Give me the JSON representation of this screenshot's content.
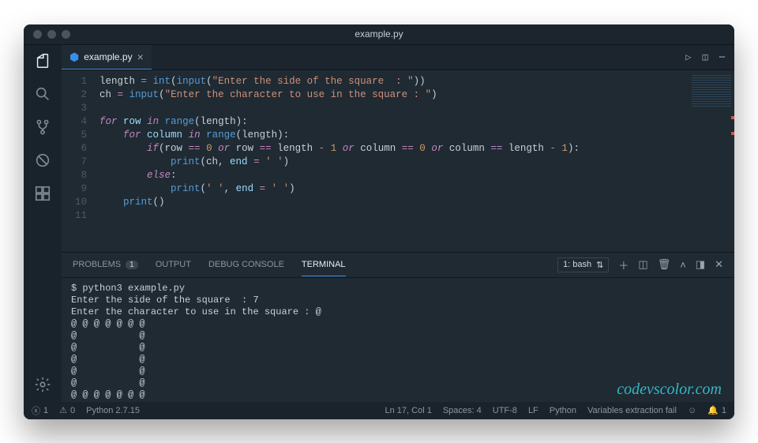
{
  "window": {
    "title": "example.py"
  },
  "tabs": {
    "file": "example.py"
  },
  "editor": {
    "lines": [
      "1",
      "2",
      "3",
      "4",
      "5",
      "6",
      "7",
      "8",
      "9",
      "10",
      "11"
    ],
    "code_html": "length <span class='tok-op'>=</span> <span class='tok-fn'>int</span>(<span class='tok-fn'>input</span>(<span class='tok-str'>\"Enter the side of the square  : \"</span>))\nch <span class='tok-op'>=</span> <span class='tok-fn'>input</span>(<span class='tok-str'>\"Enter the character to use in the square : \"</span>)\n\n<span class='tok-kw'>for</span> <span class='tok-id'>row</span> <span class='tok-kw'>in</span> <span class='tok-fn'>range</span>(length):\n    <span class='tok-kw'>for</span> <span class='tok-id'>column</span> <span class='tok-kw'>in</span> <span class='tok-fn'>range</span>(length):\n        <span class='tok-kw'>if</span>(row <span class='tok-op'>==</span> <span class='tok-num'>0</span> <span class='tok-kw'>or</span> row <span class='tok-op'>==</span> length <span class='tok-op'>-</span> <span class='tok-num'>1</span> <span class='tok-kw'>or</span> column <span class='tok-op'>==</span> <span class='tok-num'>0</span> <span class='tok-kw'>or</span> column <span class='tok-op'>==</span> length <span class='tok-op'>-</span> <span class='tok-num'>1</span>):\n            <span class='tok-fn'>print</span>(ch, <span class='tok-id'>end</span> <span class='tok-op'>=</span> <span class='tok-str'>' '</span>)\n        <span class='tok-kw'>else</span>:\n            <span class='tok-fn'>print</span>(<span class='tok-str'>' '</span>, <span class='tok-id'>end</span> <span class='tok-op'>=</span> <span class='tok-str'>' '</span>)\n    <span class='tok-fn'>print</span>()\n"
  },
  "panel": {
    "tabs": {
      "problems": "PROBLEMS",
      "problems_count": "1",
      "output": "OUTPUT",
      "debug": "DEBUG CONSOLE",
      "terminal": "TERMINAL"
    },
    "term_select": "1: bash",
    "terminal_text": "$ python3 example.py\nEnter the side of the square  : 7\nEnter the character to use in the square : @\n@ @ @ @ @ @ @ \n@           @ \n@           @ \n@           @ \n@           @ \n@           @ \n@ @ @ @ @ @ @ \n$ "
  },
  "status": {
    "errors": "1",
    "warnings": "0",
    "python": "Python 2.7.15",
    "ln": "Ln 17, Col 1",
    "spaces": "Spaces: 4",
    "enc": "UTF-8",
    "eol": "LF",
    "lang": "Python",
    "ext": "Variables extraction fail",
    "bell": "1"
  },
  "watermark": "codevscolor.com"
}
